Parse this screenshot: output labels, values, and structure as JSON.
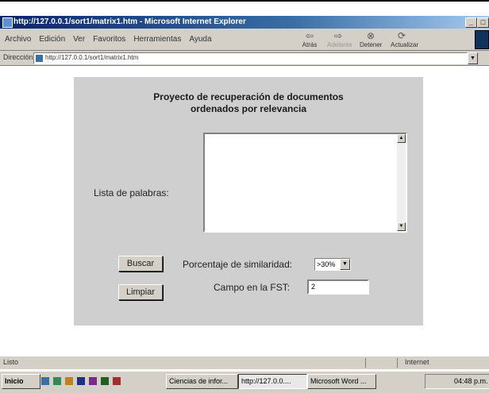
{
  "window": {
    "title": "http://127.0.0.1/sort1/matrix1.htm - Microsoft Internet Explorer"
  },
  "menu": [
    "Archivo",
    "Edición",
    "Ver",
    "Favoritos",
    "Herramientas",
    "Ayuda"
  ],
  "toolbar": {
    "back": "Atrás",
    "forward": "Adelante",
    "stop": "Detener",
    "refresh": "Actualizar"
  },
  "address": {
    "label": "Dirección",
    "value": "http://127.0.0.1/sort1/matrix1.htm"
  },
  "page": {
    "heading_line1": "Proyecto de recuperación de documentos",
    "heading_line2": "ordenados por relevancia",
    "lista_label": "Lista de palabras:",
    "buscar_label": "Buscar",
    "limpiar_label": "Limpiar",
    "porcentaje_label": "Porcentaje de similaridad:",
    "porcentaje_value": ">30%",
    "campo_label": "Campo en la FST:",
    "campo_value": "2"
  },
  "status": {
    "left": "Listo",
    "zone": "Internet"
  },
  "taskbar": {
    "start": "Inicio",
    "items": [
      "Ciencias de infor...",
      "http://127.0.0....",
      "Microsoft Word ..."
    ],
    "clock": "04:48 p.m."
  }
}
